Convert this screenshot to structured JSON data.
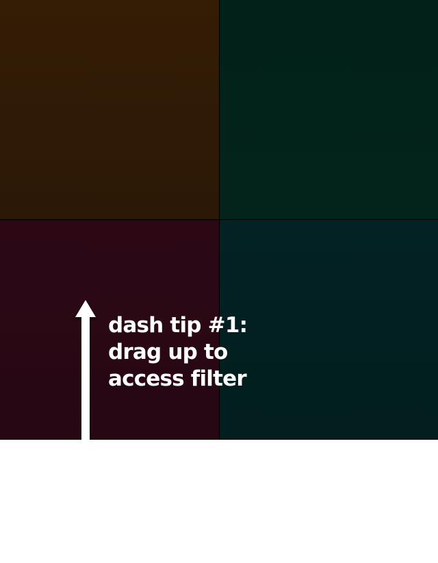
{
  "tiles": [
    {
      "id": "top-left",
      "color": "#341d05"
    },
    {
      "id": "top-right",
      "color": "#022219"
    },
    {
      "id": "bottom-left",
      "color": "#2c0815"
    },
    {
      "id": "bottom-right",
      "color": "#032224"
    }
  ],
  "tip": {
    "lines": [
      "dash tip #1:",
      "drag up to",
      "access filter"
    ],
    "arrow_icon": "up-arrow-icon",
    "text_color": "#ffffff"
  }
}
